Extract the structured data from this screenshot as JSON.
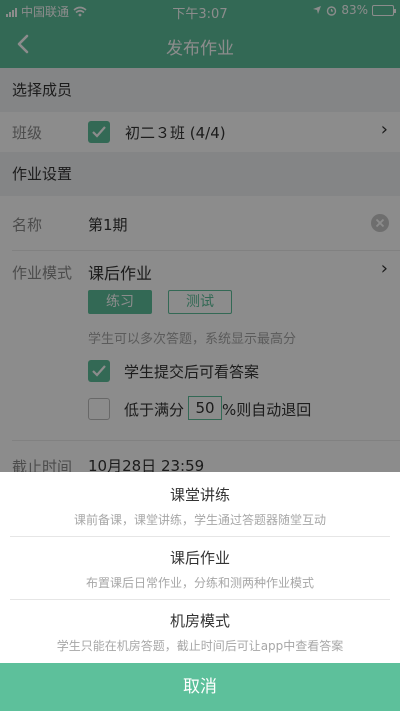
{
  "status": {
    "carrier": "中国联通",
    "time": "下午3:07",
    "battery": "83%",
    "battery_level": 0.83
  },
  "nav": {
    "title": "发布作业",
    "back_icon": "chevron-left-icon"
  },
  "members": {
    "section_title": "选择成员",
    "class_label": "班级",
    "class_value": "初二３班 (4/4)"
  },
  "settings": {
    "section_title": "作业设置",
    "name_label": "名称",
    "name_value": "第1期",
    "mode_label": "作业模式",
    "mode_value": "课后作业",
    "chip_practice": "练习",
    "chip_test": "测试",
    "hint": "学生可以多次答题，系统显示最高分",
    "show_answer_label": "学生提交后可看答案",
    "auto_return_prefix": "低于满分",
    "auto_return_value": "50",
    "auto_return_suffix": "%则自动退回",
    "deadline_label": "截止时间",
    "deadline_value": "10月28日 23:59"
  },
  "sheet": {
    "options": [
      {
        "title": "课堂讲练",
        "desc": "课前备课，课堂讲练，学生通过答题器随堂互动"
      },
      {
        "title": "课后作业",
        "desc": "布置课后日常作业，分练和测两种作业模式"
      },
      {
        "title": "机房模式",
        "desc": "学生只能在机房答题，截止时间后可让app中查看答案"
      }
    ],
    "cancel": "取消"
  },
  "colors": {
    "accent": "#5dc09b"
  }
}
